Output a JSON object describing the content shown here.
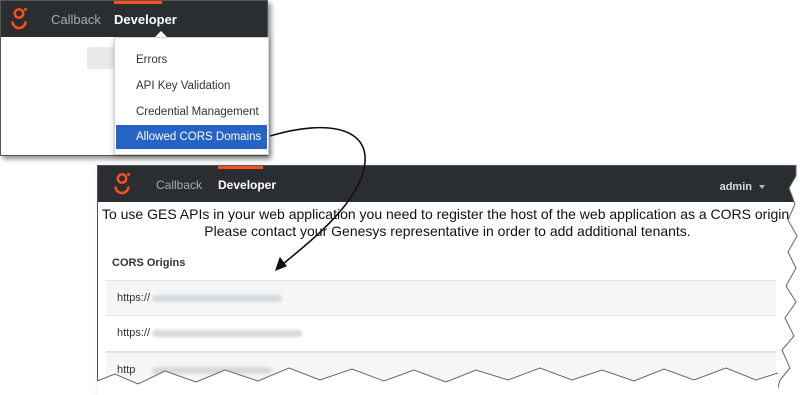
{
  "top_screenshot": {
    "nav": {
      "callback_label": "Callback",
      "developer_label": "Developer"
    },
    "menu": {
      "items": [
        {
          "label": "Errors",
          "selected": false
        },
        {
          "label": "API Key Validation",
          "selected": false
        },
        {
          "label": "Credential Management",
          "selected": false
        },
        {
          "label": "Allowed CORS Domains",
          "selected": true
        }
      ]
    }
  },
  "bottom_screenshot": {
    "nav": {
      "callback_label": "Callback",
      "developer_label": "Developer",
      "user_label": "admin"
    },
    "notice_line1": "To use GES APIs in your web application you need to register the host of the web application as a CORS origin.",
    "notice_line2": "Please contact your Genesys representative in order to add additional tenants.",
    "section_title": "CORS Origins",
    "origins": [
      {
        "prefix": "https://"
      },
      {
        "prefix": "https://"
      },
      {
        "prefix": "http"
      }
    ]
  },
  "colors": {
    "navbar": "#2b2e31",
    "accent": "#ff4f1f",
    "selected": "#2563c7"
  }
}
